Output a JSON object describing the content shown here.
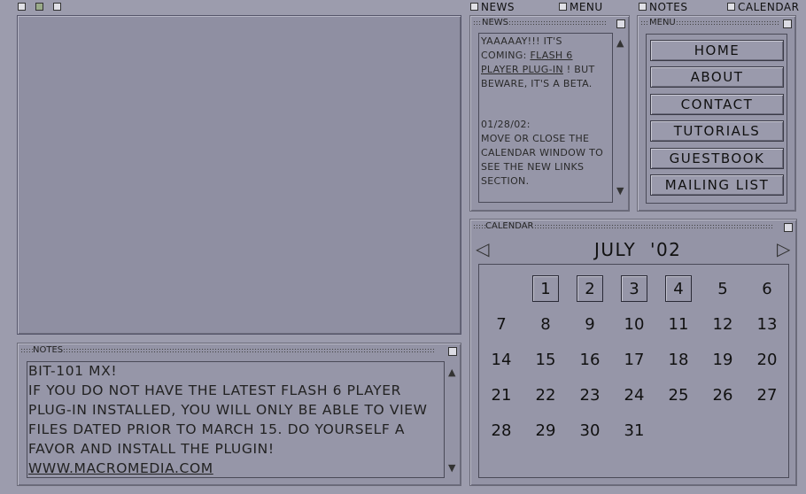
{
  "checkboxes": [
    {
      "label": "NEWS"
    },
    {
      "label": "MENU"
    },
    {
      "label": "NOTES"
    },
    {
      "label": "CALENDAR"
    }
  ],
  "news": {
    "title": "NEWS",
    "line1": "YAAAAAY!!! IT'S COMING:",
    "link": "FLASH 6 PLAYER PLUG-IN",
    "line1_tail": "! BUT BEWARE, IT'S A BETA.",
    "date": "01/28/02:",
    "line2": "MOVE OR CLOSE THE CALENDAR WINDOW TO SEE THE NEW LINKS SECTION."
  },
  "menu": {
    "title": "MENU",
    "items": [
      "HOME",
      "ABOUT",
      "CONTACT",
      "TUTORIALS",
      "GUESTBOOK",
      "MAILING LIST"
    ]
  },
  "calendar": {
    "title": "CALENDAR",
    "month_label": "JULY  '02",
    "start_offset": 1,
    "days_in_month": 31,
    "boxed_days": [
      1,
      2,
      3,
      4
    ]
  },
  "notes": {
    "title": "NOTES",
    "heading": "BIT-101 MX!",
    "body": "IF YOU DO NOT HAVE THE LATEST FLASH 6 PLAYER PLUG-IN INSTALLED, YOU WILL ONLY BE ABLE TO VIEW FILES DATED PRIOR TO MARCH 15. DO YOURSELF A FAVOR AND INSTALL THE PLUGIN!",
    "link": "WWW.MACROMEDIA.COM"
  },
  "icons": {
    "scroll_up": "▲",
    "scroll_down": "▼",
    "prev_month": "◁",
    "next_month": "▷"
  }
}
